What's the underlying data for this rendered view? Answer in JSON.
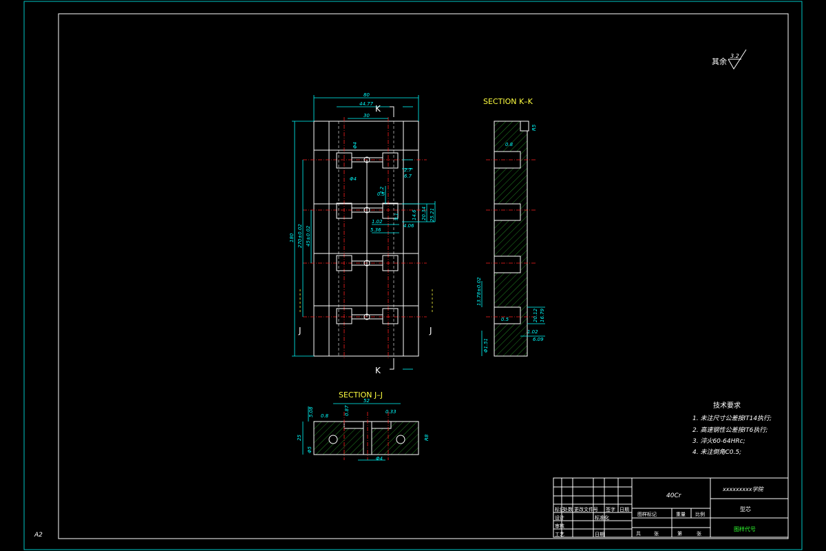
{
  "sheet": {
    "size_label": "A2"
  },
  "roughness": {
    "label": "其余",
    "value": "3.2"
  },
  "views": {
    "main": {
      "dims": {
        "overall_width": "80",
        "inner_width": "44.77",
        "slot_pitch": "30",
        "overall_height": "180",
        "h1": "270±0.02",
        "h2": "45±0.02",
        "hole_dia": "Φ4",
        "hole_dia2": "Φ4",
        "d_4_2": "4.2",
        "d_0_5": "0.5",
        "d_1_02": "1.02",
        "d_5_36": "5.36",
        "d_4_06": "4.06",
        "d_2_7": "2.7",
        "d_6_7": "6.7",
        "d_9_1": "9.1",
        "d_14_6": "14.6",
        "d_20_34": "20.34",
        "d_25_21": "25.21"
      },
      "markers": {
        "k_top": "K",
        "k_bottom": "K",
        "j_left": "J",
        "j_right": "J"
      }
    },
    "section_kk": {
      "title": "SECTION K–K",
      "dims": {
        "r": "R5",
        "gap": "0.8",
        "top": "13.78±0.02",
        "w1": "20.12",
        "w2": "16.79",
        "s1": "1.02",
        "s2": "6.09",
        "left": "Φ1.51",
        "angle": "0.5"
      }
    },
    "section_jj": {
      "title": "SECTION J–J",
      "dims": {
        "w": "52",
        "h1": "5.08",
        "h2": "25",
        "a1": "0.8",
        "a2": "0.87",
        "a3": "0.33",
        "d": "Φ4",
        "r": "R8",
        "left": "Φ5"
      }
    }
  },
  "notes": {
    "title": "技术要求",
    "items": [
      "1. 未注尺寸公差按IT14执行;",
      "2. 高速钢性公差按IT6执行;",
      "3. 淬火60-64HRc;",
      "4. 未注倒角C0.5;"
    ]
  },
  "title_block": {
    "material": "40Cr",
    "school": "xxxxxxxxx学院",
    "part_name": "型芯",
    "drawing_no": "图样代号",
    "row_labels": [
      "标记",
      "处数",
      "更改文件号",
      "签字",
      "日期"
    ],
    "design_labels": [
      "设计",
      "标准化"
    ],
    "review_label": "审核",
    "process_label": "工艺",
    "date_label": "日期",
    "stage_labels": [
      "图样标记",
      "重量",
      "比例"
    ],
    "sheet_labels": [
      "共",
      "张",
      "第",
      "张"
    ]
  }
}
